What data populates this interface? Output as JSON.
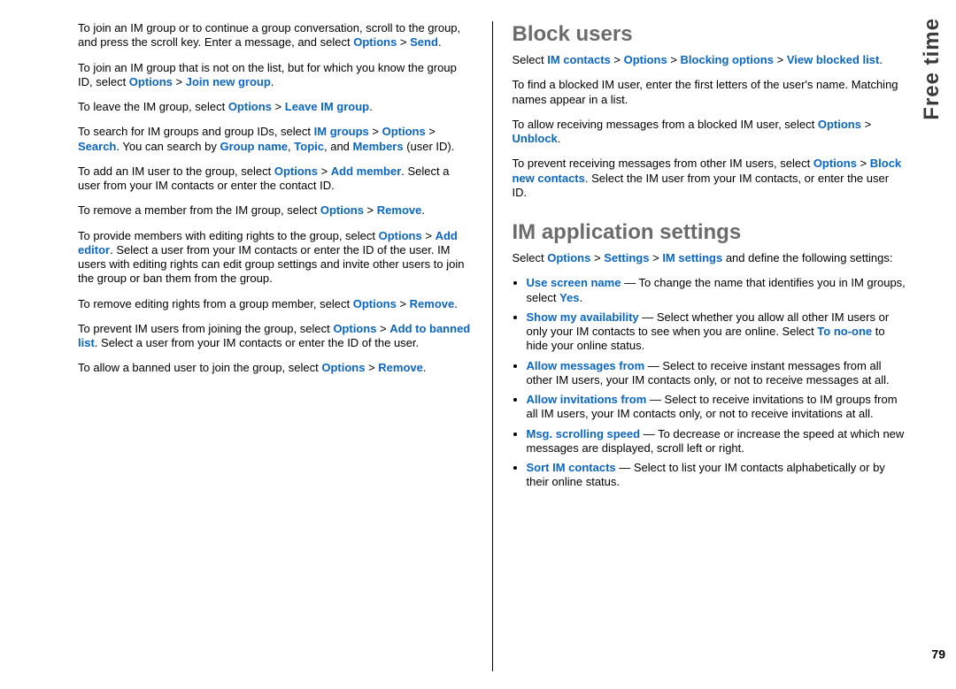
{
  "sideTab": "Free time",
  "pageNumber": "79",
  "left": {
    "p1a": "To join an IM group or to continue a group conversation, scroll to the group, and press the scroll key. Enter a message, and select ",
    "p1b": "Options",
    "p1c": "Send",
    "p2a": "To join an IM group that is not on the list, but for which you know the group ID, select ",
    "p2b": "Options",
    "p2c": "Join new group",
    "p3a": "To leave the IM group, select ",
    "p3b": "Options",
    "p3c": "Leave IM group",
    "p4a": "To search for IM groups and group IDs, select ",
    "p4b": "IM groups",
    "p4c": "Options",
    "p4d": "Search",
    "p4e": ". You can search by ",
    "p4f": "Group name",
    "p4g": "Topic",
    "p4h": ", and ",
    "p4i": "Members",
    "p4j": " (user ID).",
    "p5a": "To add an IM user to the group, select ",
    "p5b": "Options",
    "p5c": "Add member",
    "p5d": ". Select a user from your IM contacts or enter the contact ID.",
    "p6a": "To remove a member from the IM group, select ",
    "p6b": "Options",
    "p6c": "Remove",
    "p7a": "To provide members with editing rights to the group, select ",
    "p7b": "Options",
    "p7c": "Add editor",
    "p7d": ". Select a user from your IM contacts or enter the ID of the user. IM users with editing rights can edit group settings and invite other users to join the group or ban them from the group.",
    "p8a": "To remove editing rights from a group member, select ",
    "p8b": "Options",
    "p8c": "Remove",
    "p9a": "To prevent IM users from joining the group, select ",
    "p9b": "Options",
    "p9c": "Add to banned list",
    "p9d": ". Select a user from your IM contacts or enter the ID of the user.",
    "p10a": "To allow a banned user to join the group, select ",
    "p10b": "Options",
    "p10c": "Remove"
  },
  "right": {
    "h1": "Block users",
    "b1a": "Select ",
    "b1b": "IM contacts",
    "b1c": "Options",
    "b1d": "Blocking options",
    "b1e": "View blocked list",
    "b2": "To find a blocked IM user, enter the first letters of the user's name. Matching names appear in a list.",
    "b3a": "To allow receiving messages from a blocked IM user, select ",
    "b3b": "Options",
    "b3c": "Unblock",
    "b4a": "To prevent receiving messages from other IM users, select ",
    "b4b": "Options",
    "b4c": "Block new contacts",
    "b4d": ". Select the IM user from your IM contacts, or enter the user ID.",
    "h2": "IM application settings",
    "s1a": "Select ",
    "s1b": "Options",
    "s1c": "Settings",
    "s1d": "IM settings",
    "s1e": " and define the following settings:",
    "li1a": "Use screen name",
    "li1b": " — To change the name that identifies you in IM groups, select ",
    "li1c": "Yes",
    "li2a": "Show my availability",
    "li2b": " — Select whether you allow all other IM users or only your IM contacts to see when you are online. Select ",
    "li2c": "To no-one",
    "li2d": " to hide your online status.",
    "li3a": "Allow messages from",
    "li3b": " — Select to receive instant messages from all other IM users, your IM contacts only, or not to receive messages at all.",
    "li4a": "Allow invitations from",
    "li4b": " — Select to receive invitations to IM groups from all IM users, your IM contacts only, or not to receive invitations at all.",
    "li5a": "Msg. scrolling speed",
    "li5b": " — To decrease or increase the speed at which new messages are displayed, scroll left or right.",
    "li6a": "Sort IM contacts",
    "li6b": " — Select to list your IM contacts alphabetically or by their online status."
  }
}
